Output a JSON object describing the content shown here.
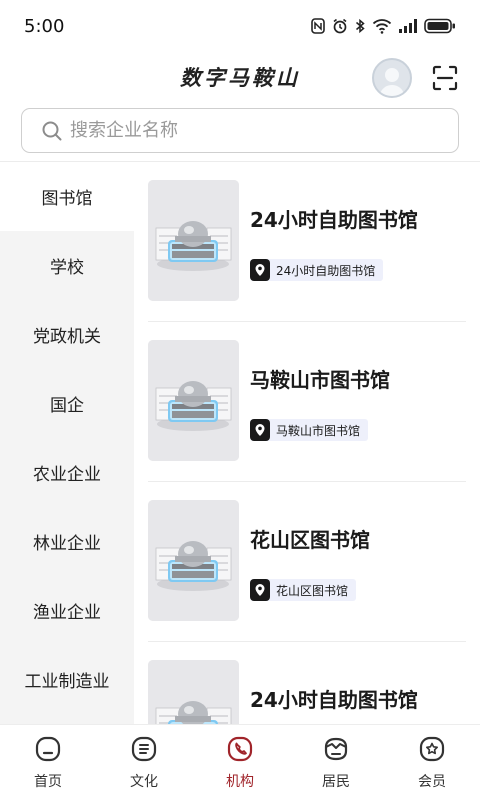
{
  "status_bar": {
    "time": "5:00"
  },
  "header": {
    "title": "数字马鞍山"
  },
  "search": {
    "placeholder": "搜索企业名称"
  },
  "sidebar": {
    "items": [
      {
        "label": "图书馆",
        "active": true
      },
      {
        "label": "学校"
      },
      {
        "label": "党政机关"
      },
      {
        "label": "国企"
      },
      {
        "label": "农业企业"
      },
      {
        "label": "林业企业"
      },
      {
        "label": "渔业企业"
      },
      {
        "label": "工业制造业"
      }
    ]
  },
  "list": {
    "items": [
      {
        "title": "24小时自助图书馆",
        "tag": "24小时自助图书馆",
        "image": "library-building-image"
      },
      {
        "title": "马鞍山市图书馆",
        "tag": "马鞍山市图书馆",
        "image": "library-building-image"
      },
      {
        "title": "花山区图书馆",
        "tag": "花山区图书馆",
        "image": "library-building-image"
      },
      {
        "title": "24小时自助图书馆",
        "tag": "",
        "image": "library-building-image"
      }
    ]
  },
  "bottom_nav": {
    "items": [
      {
        "label": "首页",
        "icon": "home-icon"
      },
      {
        "label": "文化",
        "icon": "culture-icon"
      },
      {
        "label": "机构",
        "icon": "institution-icon",
        "active": true
      },
      {
        "label": "居民",
        "icon": "residents-icon"
      },
      {
        "label": "会员",
        "icon": "member-icon"
      }
    ]
  },
  "colors": {
    "accent": "#a0242a",
    "sidebar_bg": "#f4f4f4",
    "tag_bg": "#eef0fb"
  }
}
